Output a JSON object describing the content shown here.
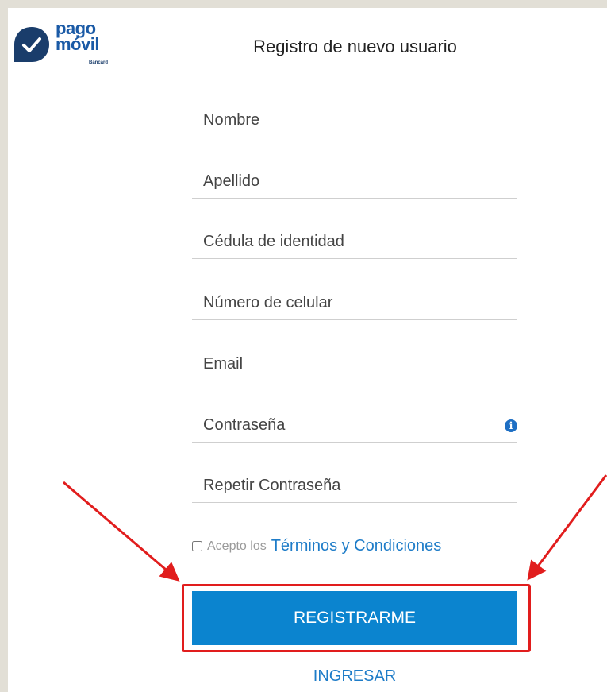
{
  "logo": {
    "line1": "pago",
    "line2": "móvil",
    "sub": "Bancard"
  },
  "title": "Registro de nuevo usuario",
  "fields": [
    {
      "placeholder": "Nombre"
    },
    {
      "placeholder": "Apellido"
    },
    {
      "placeholder": "Cédula de identidad"
    },
    {
      "placeholder": "Número de celular"
    },
    {
      "placeholder": "Email"
    },
    {
      "placeholder": "Contraseña",
      "info_icon": "info-icon"
    },
    {
      "placeholder": "Repetir Contraseña"
    }
  ],
  "terms": {
    "prefix": "Acepto los",
    "link": "Términos y Condiciones",
    "checked": false
  },
  "buttons": {
    "register": "REGISTRARME",
    "login": "INGRESAR"
  },
  "colors": {
    "brand_blue": "#1a5aa6",
    "button_blue": "#0b84cf",
    "link_blue": "#1e7cc8",
    "annotation_red": "#e11d1d"
  }
}
